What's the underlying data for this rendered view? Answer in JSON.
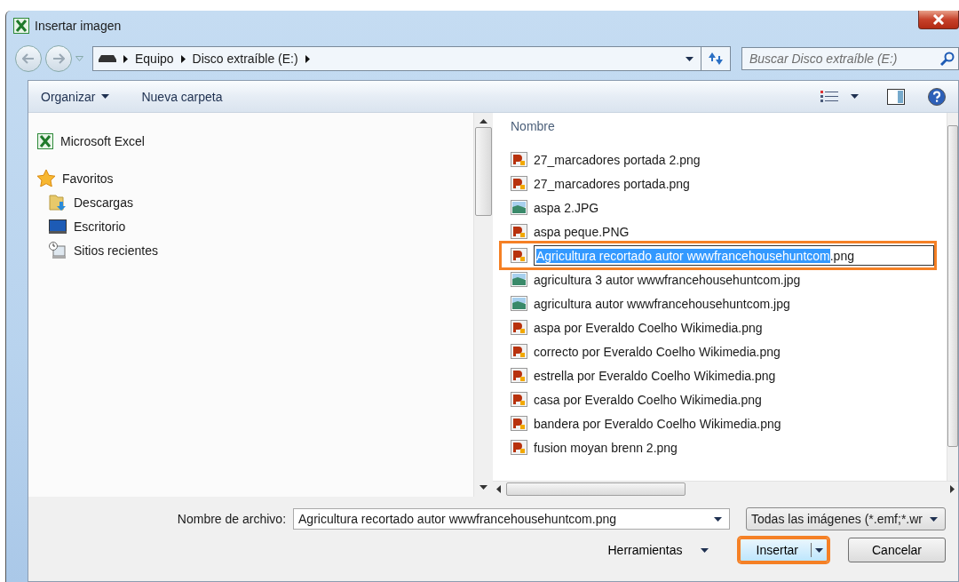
{
  "window": {
    "title": "Insertar imagen"
  },
  "address_bar": {
    "path": [
      "Equipo",
      "Disco extraíble (E:)"
    ]
  },
  "search": {
    "placeholder": "Buscar Disco extraíble (E:)"
  },
  "toolbar": {
    "organize": "Organizar",
    "new_folder": "Nueva carpeta"
  },
  "navigation": [
    {
      "label": "Microsoft Excel",
      "kind": "excel"
    },
    {
      "label": "Favoritos",
      "kind": "star",
      "children": [
        {
          "label": "Descargas",
          "kind": "downloads"
        },
        {
          "label": "Escritorio",
          "kind": "desktop"
        },
        {
          "label": "Sitios recientes",
          "kind": "recent"
        }
      ]
    }
  ],
  "file_list": {
    "column": "Nombre",
    "files": [
      {
        "name": "27_marcadores portada 2.png",
        "kind": "png",
        "editing": false,
        "highlighted": false
      },
      {
        "name": "27_marcadores portada.png",
        "kind": "png",
        "editing": false,
        "highlighted": false
      },
      {
        "name": "aspa 2.JPG",
        "kind": "jpg",
        "editing": false,
        "highlighted": false
      },
      {
        "name": "aspa peque.PNG",
        "kind": "png",
        "editing": false,
        "highlighted": false
      },
      {
        "name_selected": "Agricultura recortado autor wwwfrancehousehuntcom",
        "name_rest": ".png",
        "kind": "png",
        "editing": true,
        "highlighted": true
      },
      {
        "name": "agricultura 3 autor wwwfrancehousehuntcom.jpg",
        "kind": "jpg",
        "editing": false,
        "highlighted": false
      },
      {
        "name": "agricultura autor wwwfrancehousehuntcom.jpg",
        "kind": "jpg",
        "editing": false,
        "highlighted": false
      },
      {
        "name": "aspa por Everaldo Coelho Wikimedia.png",
        "kind": "png",
        "editing": false,
        "highlighted": false
      },
      {
        "name": "correcto por Everaldo Coelho Wikimedia.png",
        "kind": "png",
        "editing": false,
        "highlighted": false
      },
      {
        "name": "estrella por Everaldo Coelho Wikimedia.png",
        "kind": "png",
        "editing": false,
        "highlighted": false
      },
      {
        "name": "casa por Everaldo Coelho Wikimedia.png",
        "kind": "png",
        "editing": false,
        "highlighted": false
      },
      {
        "name": "bandera por Everaldo Coelho Wikimedia.png",
        "kind": "png",
        "editing": false,
        "highlighted": false
      },
      {
        "name": "fusion moyan brenn 2.png",
        "kind": "png",
        "editing": false,
        "highlighted": false
      }
    ]
  },
  "footer": {
    "filename_label": "Nombre de archivo:",
    "filename_value": "Agricultura recortado autor wwwfrancehousehuntcom.png",
    "filter": "Todas las imágenes (*.emf;*.wr",
    "tools": "Herramientas",
    "buttons": [
      {
        "label": "Insertar",
        "kind": "split",
        "highlighted": true
      },
      {
        "label": "Cancelar",
        "kind": "plain",
        "highlighted": false
      }
    ]
  }
}
